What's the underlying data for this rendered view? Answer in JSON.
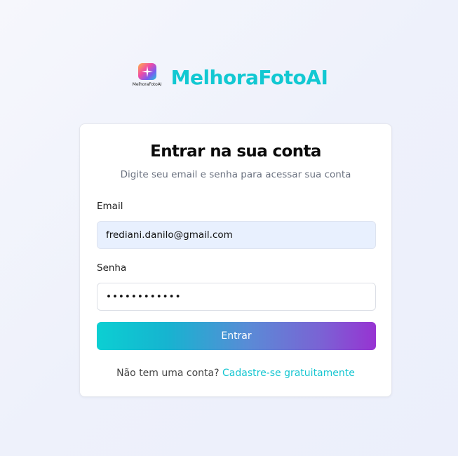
{
  "brand": {
    "logo_caption": "MelhoraFotoAI",
    "name": "MelhoraFotoAI",
    "color": "#12c8d2"
  },
  "login": {
    "title": "Entrar na sua conta",
    "subtitle": "Digite seu email e senha para acessar sua conta",
    "email_label": "Email",
    "email_value": "frediani.danilo@gmail.com",
    "password_label": "Senha",
    "password_value": "••••••••••••",
    "submit_label": "Entrar",
    "signup_prompt": "Não tem uma conta?",
    "signup_link": "Cadastre-se gratuitamente"
  },
  "colors": {
    "accent": "#12c8d2",
    "button_gradient_start": "#0ccfd2",
    "button_gradient_end": "#9733d2",
    "email_field_bg": "#e8f0fe"
  }
}
